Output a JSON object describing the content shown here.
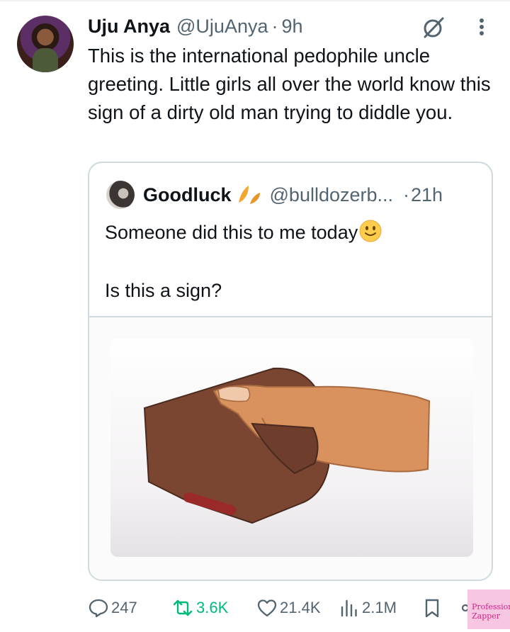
{
  "post": {
    "author_name": "Uju Anya",
    "author_handle": "@UjuAnya",
    "separator": "·",
    "time": "9h",
    "text": "This is the international pedophile uncle greeting. Little girls all over the world know this sign of a dirty old man trying to diddle you."
  },
  "quote": {
    "author_name": "Goodluck",
    "author_handle": "@bulldozerb...",
    "separator": "·",
    "time": "21h",
    "text_line1": "Someone did this to me today",
    "text_line2": "Is this a sign?"
  },
  "actions": {
    "replies": "247",
    "reposts": "3.6K",
    "likes": "21.4K",
    "views": "2.1M"
  },
  "watermark": {
    "text": "Professional Zapper"
  },
  "icons": {
    "grok": "grok-icon",
    "more": "more-vertical-icon",
    "reply": "reply-icon",
    "repost": "repost-icon",
    "like": "heart-icon",
    "views": "views-icon",
    "bookmark": "bookmark-icon",
    "share": "share-icon"
  },
  "colors": {
    "text": "#0f1419",
    "secondary": "#536471",
    "border": "#cfd9de",
    "repost": "#00ba7c",
    "watermark_bg": "#f7c6e0"
  }
}
